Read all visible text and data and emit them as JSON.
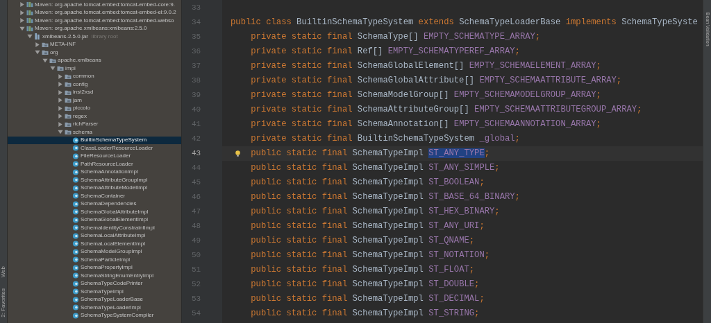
{
  "left_toolbar": {
    "tabs": [
      {
        "label": "Web"
      },
      {
        "label": "2: Favorites"
      }
    ]
  },
  "project_tree": {
    "items": [
      {
        "kind": "library",
        "label": "Maven: org.apache.tomcat.embed:tomcat-embed-core:9.",
        "expanded": false,
        "selected": false
      },
      {
        "kind": "library",
        "label": "Maven: org.apache.tomcat.embed:tomcat-embed-el:9.0.2",
        "expanded": false,
        "selected": false
      },
      {
        "kind": "library",
        "label": "Maven: org.apache.tomcat.embed:tomcat-embed-webso",
        "expanded": false,
        "selected": false
      },
      {
        "kind": "library",
        "label": "Maven: org.apache.xmlbeans:xmlbeans:2.5.0",
        "expanded": true,
        "selected": false,
        "children": [
          {
            "kind": "jar",
            "label": "xmlbeans-2.5.0.jar",
            "hint": "library root",
            "expanded": true,
            "selected": false,
            "children": [
              {
                "kind": "folder",
                "label": "META-INF",
                "expanded": false,
                "selected": false
              },
              {
                "kind": "folder",
                "label": "org",
                "expanded": true,
                "selected": false,
                "children": [
                  {
                    "kind": "folder",
                    "label": "apache.xmlbeans",
                    "expanded": true,
                    "selected": false,
                    "children": [
                      {
                        "kind": "folder",
                        "label": "impl",
                        "expanded": true,
                        "selected": false,
                        "children": [
                          {
                            "kind": "folder",
                            "label": "common",
                            "expanded": false,
                            "selected": false
                          },
                          {
                            "kind": "folder",
                            "label": "config",
                            "expanded": false,
                            "selected": false
                          },
                          {
                            "kind": "folder",
                            "label": "inst2xsd",
                            "expanded": false,
                            "selected": false
                          },
                          {
                            "kind": "folder",
                            "label": "jam",
                            "expanded": false,
                            "selected": false
                          },
                          {
                            "kind": "folder",
                            "label": "piccolo",
                            "expanded": false,
                            "selected": false
                          },
                          {
                            "kind": "folder",
                            "label": "regex",
                            "expanded": false,
                            "selected": false
                          },
                          {
                            "kind": "folder",
                            "label": "richParser",
                            "expanded": false,
                            "selected": false
                          },
                          {
                            "kind": "folder",
                            "label": "schema",
                            "expanded": true,
                            "selected": false,
                            "children": [
                              {
                                "kind": "class",
                                "label": "BuiltinSchemaTypeSystem",
                                "selected": true
                              },
                              {
                                "kind": "class",
                                "label": "ClassLoaderResourceLoader",
                                "selected": false
                              },
                              {
                                "kind": "class",
                                "label": "FileResourceLoader",
                                "selected": false
                              },
                              {
                                "kind": "class",
                                "label": "PathResourceLoader",
                                "selected": false
                              },
                              {
                                "kind": "class",
                                "label": "SchemaAnnotationImpl",
                                "selected": false
                              },
                              {
                                "kind": "class",
                                "label": "SchemaAttributeGroupImpl",
                                "selected": false
                              },
                              {
                                "kind": "class",
                                "label": "SchemaAttributeModelImpl",
                                "selected": false
                              },
                              {
                                "kind": "class",
                                "label": "SchemaContainer",
                                "selected": false
                              },
                              {
                                "kind": "class",
                                "label": "SchemaDependencies",
                                "selected": false
                              },
                              {
                                "kind": "class",
                                "label": "SchemaGlobalAttributeImpl",
                                "selected": false
                              },
                              {
                                "kind": "class",
                                "label": "SchemaGlobalElementImpl",
                                "selected": false
                              },
                              {
                                "kind": "class",
                                "label": "SchemaIdentityConstraintImpl",
                                "selected": false
                              },
                              {
                                "kind": "class",
                                "label": "SchemaLocalAttributeImpl",
                                "selected": false
                              },
                              {
                                "kind": "class",
                                "label": "SchemaLocalElementImpl",
                                "selected": false
                              },
                              {
                                "kind": "class",
                                "label": "SchemaModelGroupImpl",
                                "selected": false
                              },
                              {
                                "kind": "class",
                                "label": "SchemaParticleImpl",
                                "selected": false
                              },
                              {
                                "kind": "class",
                                "label": "SchemaPropertyImpl",
                                "selected": false
                              },
                              {
                                "kind": "class",
                                "label": "SchemaStringEnumEntryImpl",
                                "selected": false
                              },
                              {
                                "kind": "class",
                                "label": "SchemaTypeCodePrinter",
                                "selected": false
                              },
                              {
                                "kind": "class",
                                "label": "SchemaTypeImpl",
                                "selected": false
                              },
                              {
                                "kind": "class",
                                "label": "SchemaTypeLoaderBase",
                                "selected": false
                              },
                              {
                                "kind": "class",
                                "label": "SchemaTypeLoaderImpl",
                                "selected": false
                              },
                              {
                                "kind": "class",
                                "label": "SchemaTypeSystemCompiler",
                                "selected": false
                              }
                            ]
                          }
                        ]
                      }
                    ]
                  }
                ]
              }
            ]
          }
        ]
      }
    ]
  },
  "editor": {
    "lines": [
      {
        "number": "33",
        "current": false
      },
      {
        "number": "34",
        "current": false,
        "tokens": [
          {
            "kind": "keyword",
            "text": "public class "
          },
          {
            "kind": "plain",
            "text": "BuiltinSchemaTypeSystem "
          },
          {
            "kind": "keyword",
            "text": "extends "
          },
          {
            "kind": "plain",
            "text": "SchemaTypeLoaderBase "
          },
          {
            "kind": "keyword",
            "text": "implements "
          },
          {
            "kind": "plain",
            "text": "SchemaTypeSyste"
          }
        ]
      },
      {
        "number": "35",
        "current": false,
        "tokens": [
          {
            "kind": "keyword",
            "text": "    private static final "
          },
          {
            "kind": "plain",
            "text": "SchemaType[] "
          },
          {
            "kind": "field",
            "text": "EMPTY_SCHEMATYPE_ARRAY"
          },
          {
            "kind": "keyword",
            "text": ";"
          }
        ]
      },
      {
        "number": "36",
        "current": false,
        "tokens": [
          {
            "kind": "keyword",
            "text": "    private static final "
          },
          {
            "kind": "plain",
            "text": "Ref[] "
          },
          {
            "kind": "field",
            "text": "EMPTY_SCHEMATYPEREF_ARRAY"
          },
          {
            "kind": "keyword",
            "text": ";"
          }
        ]
      },
      {
        "number": "37",
        "current": false,
        "tokens": [
          {
            "kind": "keyword",
            "text": "    private static final "
          },
          {
            "kind": "plain",
            "text": "SchemaGlobalElement[] "
          },
          {
            "kind": "field",
            "text": "EMPTY_SCHEMAELEMENT_ARRAY"
          },
          {
            "kind": "keyword",
            "text": ";"
          }
        ]
      },
      {
        "number": "38",
        "current": false,
        "tokens": [
          {
            "kind": "keyword",
            "text": "    private static final "
          },
          {
            "kind": "plain",
            "text": "SchemaGlobalAttribute[] "
          },
          {
            "kind": "field",
            "text": "EMPTY_SCHEMAATTRIBUTE_ARRAY"
          },
          {
            "kind": "keyword",
            "text": ";"
          }
        ]
      },
      {
        "number": "39",
        "current": false,
        "tokens": [
          {
            "kind": "keyword",
            "text": "    private static final "
          },
          {
            "kind": "plain",
            "text": "SchemaModelGroup[] "
          },
          {
            "kind": "field",
            "text": "EMPTY_SCHEMAMODELGROUP_ARRAY"
          },
          {
            "kind": "keyword",
            "text": ";"
          }
        ]
      },
      {
        "number": "40",
        "current": false,
        "tokens": [
          {
            "kind": "keyword",
            "text": "    private static final "
          },
          {
            "kind": "plain",
            "text": "SchemaAttributeGroup[] "
          },
          {
            "kind": "field",
            "text": "EMPTY_SCHEMAATTRIBUTEGROUP_ARRAY"
          },
          {
            "kind": "keyword",
            "text": ";"
          }
        ]
      },
      {
        "number": "41",
        "current": false,
        "tokens": [
          {
            "kind": "keyword",
            "text": "    private static final "
          },
          {
            "kind": "plain",
            "text": "SchemaAnnotation[] "
          },
          {
            "kind": "field",
            "text": "EMPTY_SCHEMAANNOTATION_ARRAY"
          },
          {
            "kind": "keyword",
            "text": ";"
          }
        ]
      },
      {
        "number": "42",
        "current": false,
        "tokens": [
          {
            "kind": "keyword",
            "text": "    private static final "
          },
          {
            "kind": "plain",
            "text": "BuiltinSchemaTypeSystem "
          },
          {
            "kind": "field",
            "text": "_global"
          },
          {
            "kind": "keyword",
            "text": ";"
          }
        ]
      },
      {
        "number": "43",
        "current": true,
        "tokens": [
          {
            "kind": "keyword",
            "text": "    public static final "
          },
          {
            "kind": "plain",
            "text": "SchemaTypeImpl "
          },
          {
            "kind": "selection",
            "text": "ST_ANY_TYPE"
          },
          {
            "kind": "keyword",
            "text": ";"
          }
        ]
      },
      {
        "number": "44",
        "current": false,
        "tokens": [
          {
            "kind": "keyword",
            "text": "    public static final "
          },
          {
            "kind": "plain",
            "text": "SchemaTypeImpl "
          },
          {
            "kind": "field",
            "text": "ST_ANY_SIMPLE"
          },
          {
            "kind": "keyword",
            "text": ";"
          }
        ]
      },
      {
        "number": "45",
        "current": false,
        "tokens": [
          {
            "kind": "keyword",
            "text": "    public static final "
          },
          {
            "kind": "plain",
            "text": "SchemaTypeImpl "
          },
          {
            "kind": "field",
            "text": "ST_BOOLEAN"
          },
          {
            "kind": "keyword",
            "text": ";"
          }
        ]
      },
      {
        "number": "46",
        "current": false,
        "tokens": [
          {
            "kind": "keyword",
            "text": "    public static final "
          },
          {
            "kind": "plain",
            "text": "SchemaTypeImpl "
          },
          {
            "kind": "field",
            "text": "ST_BASE_64_BINARY"
          },
          {
            "kind": "keyword",
            "text": ";"
          }
        ]
      },
      {
        "number": "47",
        "current": false,
        "tokens": [
          {
            "kind": "keyword",
            "text": "    public static final "
          },
          {
            "kind": "plain",
            "text": "SchemaTypeImpl "
          },
          {
            "kind": "field",
            "text": "ST_HEX_BINARY"
          },
          {
            "kind": "keyword",
            "text": ";"
          }
        ]
      },
      {
        "number": "48",
        "current": false,
        "tokens": [
          {
            "kind": "keyword",
            "text": "    public static final "
          },
          {
            "kind": "plain",
            "text": "SchemaTypeImpl "
          },
          {
            "kind": "field",
            "text": "ST_ANY_URI"
          },
          {
            "kind": "keyword",
            "text": ";"
          }
        ]
      },
      {
        "number": "49",
        "current": false,
        "tokens": [
          {
            "kind": "keyword",
            "text": "    public static final "
          },
          {
            "kind": "plain",
            "text": "SchemaTypeImpl "
          },
          {
            "kind": "field",
            "text": "ST_QNAME"
          },
          {
            "kind": "keyword",
            "text": ";"
          }
        ]
      },
      {
        "number": "50",
        "current": false,
        "tokens": [
          {
            "kind": "keyword",
            "text": "    public static final "
          },
          {
            "kind": "plain",
            "text": "SchemaTypeImpl "
          },
          {
            "kind": "field",
            "text": "ST_NOTATION"
          },
          {
            "kind": "keyword",
            "text": ";"
          }
        ]
      },
      {
        "number": "51",
        "current": false,
        "tokens": [
          {
            "kind": "keyword",
            "text": "    public static final "
          },
          {
            "kind": "plain",
            "text": "SchemaTypeImpl "
          },
          {
            "kind": "field",
            "text": "ST_FLOAT"
          },
          {
            "kind": "keyword",
            "text": ";"
          }
        ]
      },
      {
        "number": "52",
        "current": false,
        "tokens": [
          {
            "kind": "keyword",
            "text": "    public static final "
          },
          {
            "kind": "plain",
            "text": "SchemaTypeImpl "
          },
          {
            "kind": "field",
            "text": "ST_DOUBLE"
          },
          {
            "kind": "keyword",
            "text": ";"
          }
        ]
      },
      {
        "number": "53",
        "current": false,
        "tokens": [
          {
            "kind": "keyword",
            "text": "    public static final "
          },
          {
            "kind": "plain",
            "text": "SchemaTypeImpl "
          },
          {
            "kind": "field",
            "text": "ST_DECIMAL"
          },
          {
            "kind": "keyword",
            "text": ";"
          }
        ]
      },
      {
        "number": "54",
        "current": false,
        "tokens": [
          {
            "kind": "keyword",
            "text": "    public static final "
          },
          {
            "kind": "plain",
            "text": "SchemaTypeImpl "
          },
          {
            "kind": "field",
            "text": "ST_STRING"
          },
          {
            "kind": "keyword",
            "text": ";"
          }
        ]
      }
    ]
  },
  "right_toolbar": {
    "tabs": [
      {
        "label": "Bean Validation"
      }
    ]
  }
}
